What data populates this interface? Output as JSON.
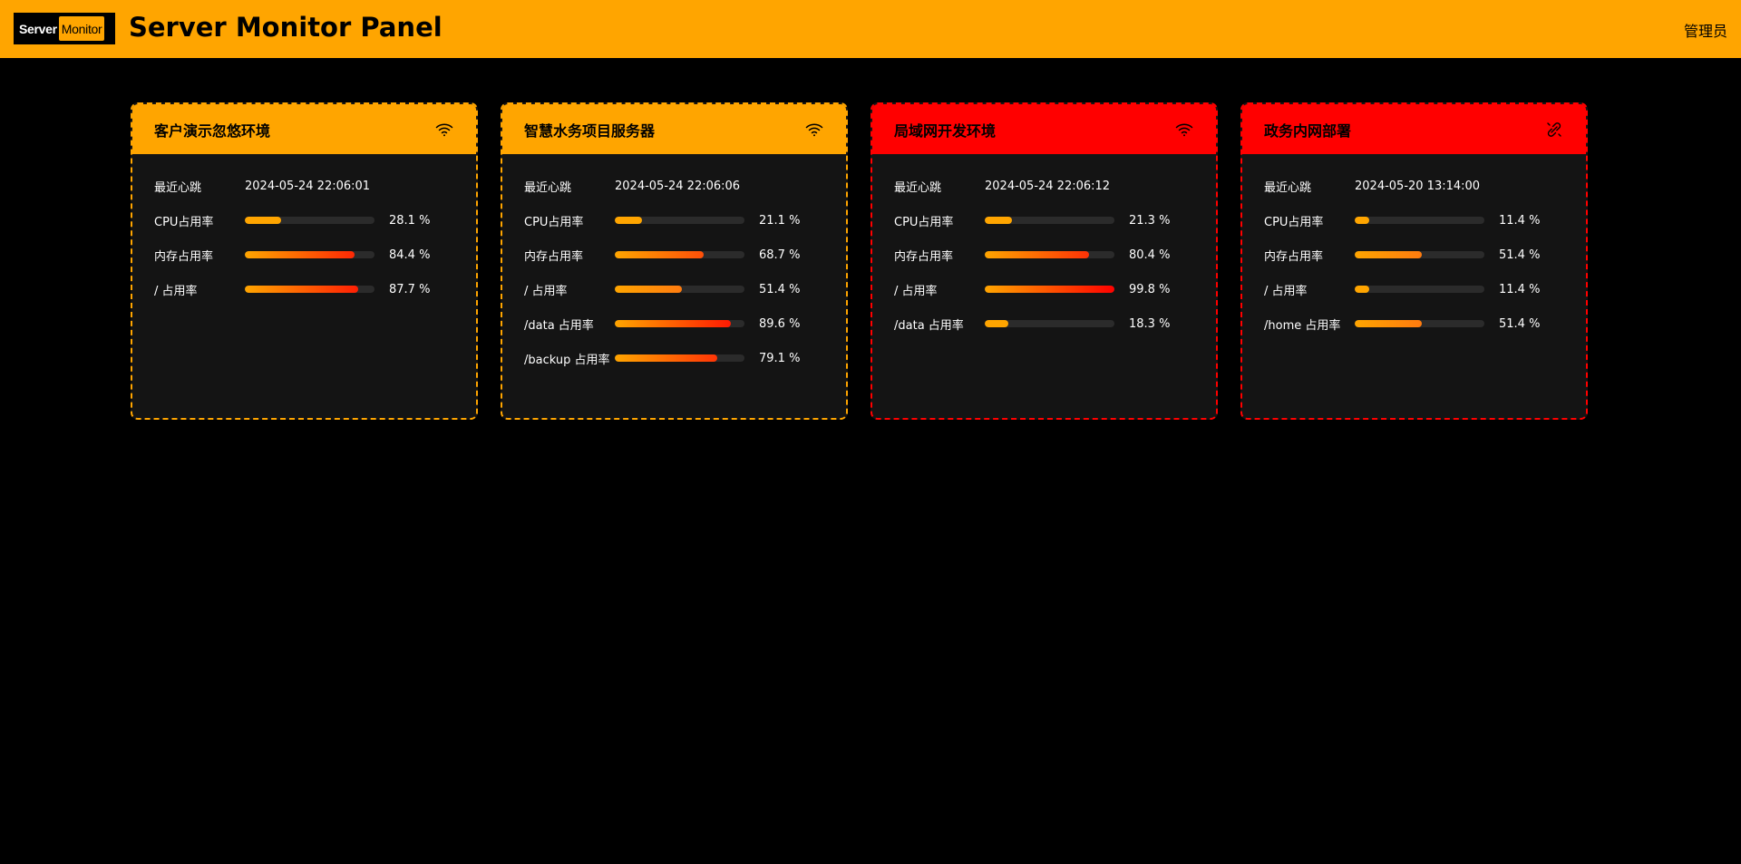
{
  "header": {
    "logo_left": "Server",
    "logo_right": "Monitor",
    "title": "Server Monitor Panel",
    "user": "管理员"
  },
  "colors": {
    "accent": "#ffa500",
    "alert": "#ff0000",
    "card_bg": "#141414",
    "track": "#2b2b2b"
  },
  "servers": [
    {
      "name": "客户演示忽悠环境",
      "status": "normal",
      "icon": "wifi-icon",
      "heartbeat_label": "最近心跳",
      "heartbeat": "2024-05-24 22:06:01",
      "metrics": [
        {
          "label": "CPU占用率",
          "value": 28.1,
          "text": "28.1 %"
        },
        {
          "label": "内存占用率",
          "value": 84.4,
          "text": "84.4 %"
        },
        {
          "label": "/ 占用率",
          "value": 87.7,
          "text": "87.7 %"
        }
      ]
    },
    {
      "name": "智慧水务项目服务器",
      "status": "normal",
      "icon": "wifi-icon",
      "heartbeat_label": "最近心跳",
      "heartbeat": "2024-05-24 22:06:06",
      "metrics": [
        {
          "label": "CPU占用率",
          "value": 21.1,
          "text": "21.1 %"
        },
        {
          "label": "内存占用率",
          "value": 68.7,
          "text": "68.7 %"
        },
        {
          "label": "/ 占用率",
          "value": 51.4,
          "text": "51.4 %"
        },
        {
          "label": "/data 占用率",
          "value": 89.6,
          "text": "89.6 %"
        },
        {
          "label": "/backup 占用率",
          "value": 79.1,
          "text": "79.1 %"
        }
      ]
    },
    {
      "name": "局域网开发环境",
      "status": "alert",
      "icon": "wifi-icon",
      "heartbeat_label": "最近心跳",
      "heartbeat": "2024-05-24 22:06:12",
      "metrics": [
        {
          "label": "CPU占用率",
          "value": 21.3,
          "text": "21.3 %"
        },
        {
          "label": "内存占用率",
          "value": 80.4,
          "text": "80.4 %"
        },
        {
          "label": "/ 占用率",
          "value": 99.8,
          "text": "99.8 %"
        },
        {
          "label": "/data 占用率",
          "value": 18.3,
          "text": "18.3 %"
        }
      ]
    },
    {
      "name": "政务内网部署",
      "status": "alert",
      "icon": "broken-link-icon",
      "heartbeat_label": "最近心跳",
      "heartbeat": "2024-05-20 13:14:00",
      "metrics": [
        {
          "label": "CPU占用率",
          "value": 11.4,
          "text": "11.4 %"
        },
        {
          "label": "内存占用率",
          "value": 51.4,
          "text": "51.4 %"
        },
        {
          "label": "/ 占用率",
          "value": 11.4,
          "text": "11.4 %"
        },
        {
          "label": "/home 占用率",
          "value": 51.4,
          "text": "51.4 %"
        }
      ]
    }
  ]
}
